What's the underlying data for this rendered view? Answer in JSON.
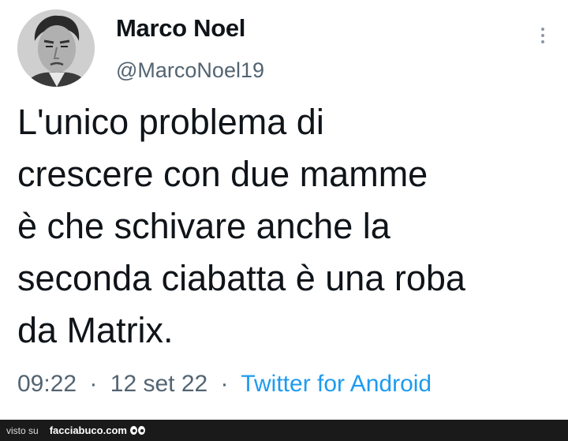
{
  "tweet": {
    "display_name": "Marco Noel",
    "handle": "@MarcoNoel19",
    "text_lines": [
      "L'unico problema di",
      "crescere con due mamme",
      "è che schivare anche la",
      "seconda ciabatta è una roba",
      "da Matrix."
    ],
    "time": "09:22",
    "date": "12 set 22",
    "separator": "·",
    "source": "Twitter for Android",
    "avatar_icon": "profile-photo",
    "more_icon": "more-vertical-icon"
  },
  "footer": {
    "prefix": "visto su",
    "brand": "facciabuco.com",
    "background": "#1a1a1a"
  },
  "colors": {
    "text": "#0f1419",
    "secondary": "#536471",
    "link": "#1d9bf0"
  }
}
